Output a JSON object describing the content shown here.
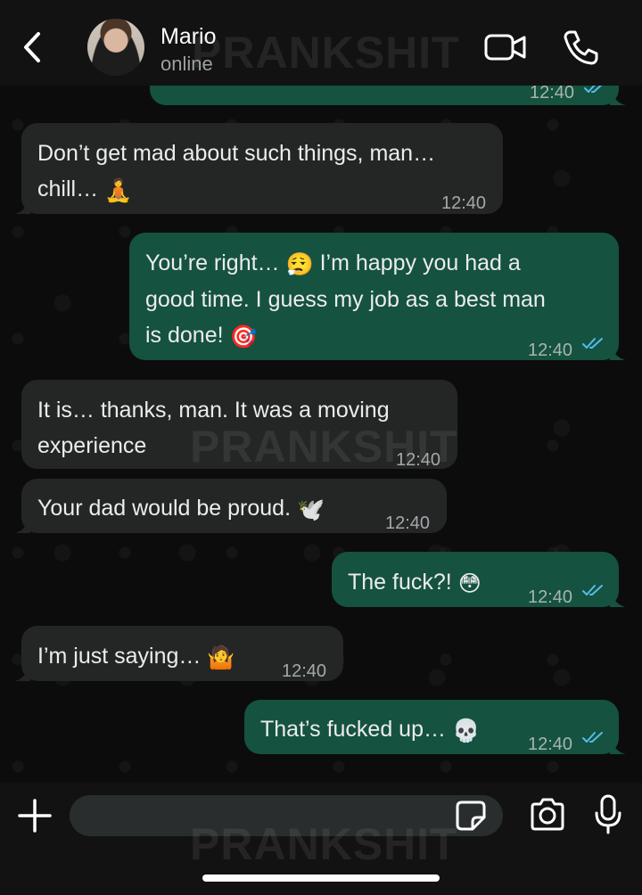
{
  "header": {
    "contact_name": "Mario",
    "status": "online"
  },
  "watermark": "PRANKSHIT",
  "messages": [
    {
      "dir": "out",
      "lines": [
        ""
      ],
      "time": "12:40",
      "read": true
    },
    {
      "dir": "in",
      "lines": [
        "Don’t get mad about such things, man…",
        "chill…"
      ],
      "emoji": "🧘",
      "time": "12:40"
    },
    {
      "dir": "out",
      "lines": [
        "You’re right…",
        "I’m happy you had a",
        "good time. I guess my job as a best man",
        "is done!"
      ],
      "emoji_a": "😮‍💨",
      "emoji_b": "🎯",
      "time": "12:40",
      "read": true
    },
    {
      "dir": "in",
      "lines": [
        "It is… thanks, man. It was a moving",
        "experience"
      ],
      "time": "12:40"
    },
    {
      "dir": "in",
      "lines": [
        "Your dad would be proud."
      ],
      "emoji": "🕊️",
      "time": "12:40"
    },
    {
      "dir": "out",
      "lines": [
        "The fuck?!"
      ],
      "emoji": "😳",
      "time": "12:40",
      "read": true
    },
    {
      "dir": "in",
      "lines": [
        "I’m just saying…"
      ],
      "emoji": "🤷",
      "time": "12:40"
    },
    {
      "dir": "out",
      "lines": [
        "That’s fucked up…"
      ],
      "emoji": "💀",
      "time": "12:40",
      "read": true
    }
  ],
  "composer": {
    "placeholder": ""
  },
  "colors": {
    "incoming_bubble": "#242626",
    "outgoing_bubble": "#155240",
    "read_ticks": "#53bdeb",
    "header_bg": "#121212"
  },
  "icons": {
    "back": "chevron-left-icon",
    "video": "video-camera-icon",
    "call": "phone-icon",
    "plus": "plus-icon",
    "sticker": "sticker-icon",
    "camera": "camera-icon",
    "mic": "microphone-icon"
  }
}
